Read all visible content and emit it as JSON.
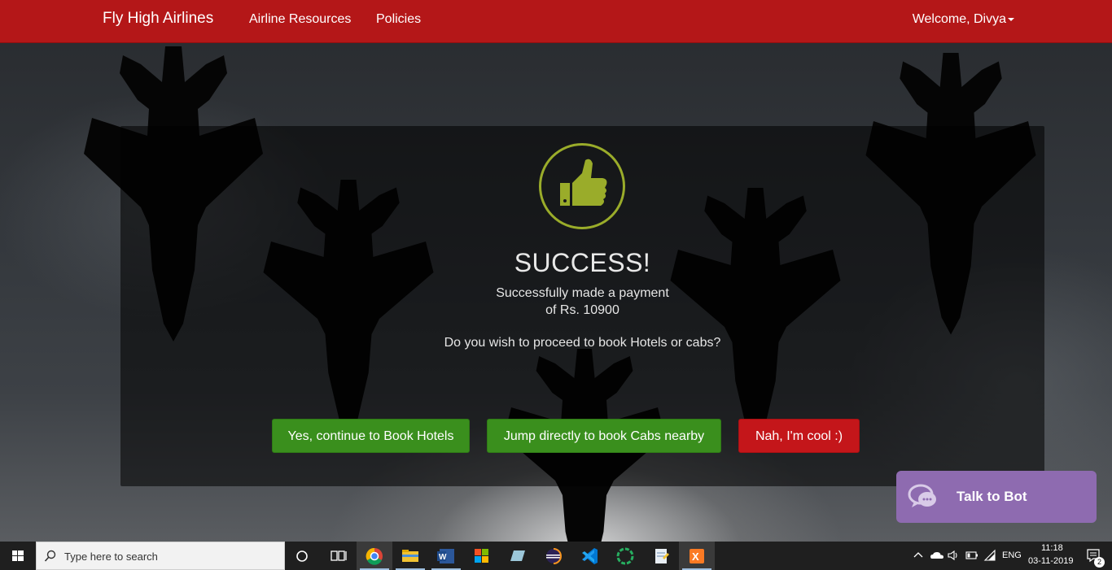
{
  "navbar": {
    "brand": "Fly High Airlines",
    "links": [
      "Airline Resources",
      "Policies"
    ],
    "welcome": "Welcome, Divya"
  },
  "success": {
    "title": "SUCCESS!",
    "message_line1": "Successfully made a payment",
    "message_line2": "of Rs. 10900",
    "question": "Do you wish to proceed to book Hotels or cabs?",
    "icon": "thumbs-up-icon",
    "accent_color": "#9aac2a"
  },
  "buttons": {
    "hotels": "Yes, continue to Book Hotels",
    "cabs": "Jump directly to book Cabs nearby",
    "decline": "Nah, I'm cool :)"
  },
  "bot": {
    "label": "Talk to Bot",
    "color": "#8e6bb0"
  },
  "taskbar": {
    "search_placeholder": "Type here to search",
    "language": "ENG",
    "time": "11:18",
    "date": "03-11-2019",
    "notification_count": "2"
  },
  "colors": {
    "navbar": "#b41718",
    "green": "#3a8f1d",
    "red": "#c4161a"
  }
}
